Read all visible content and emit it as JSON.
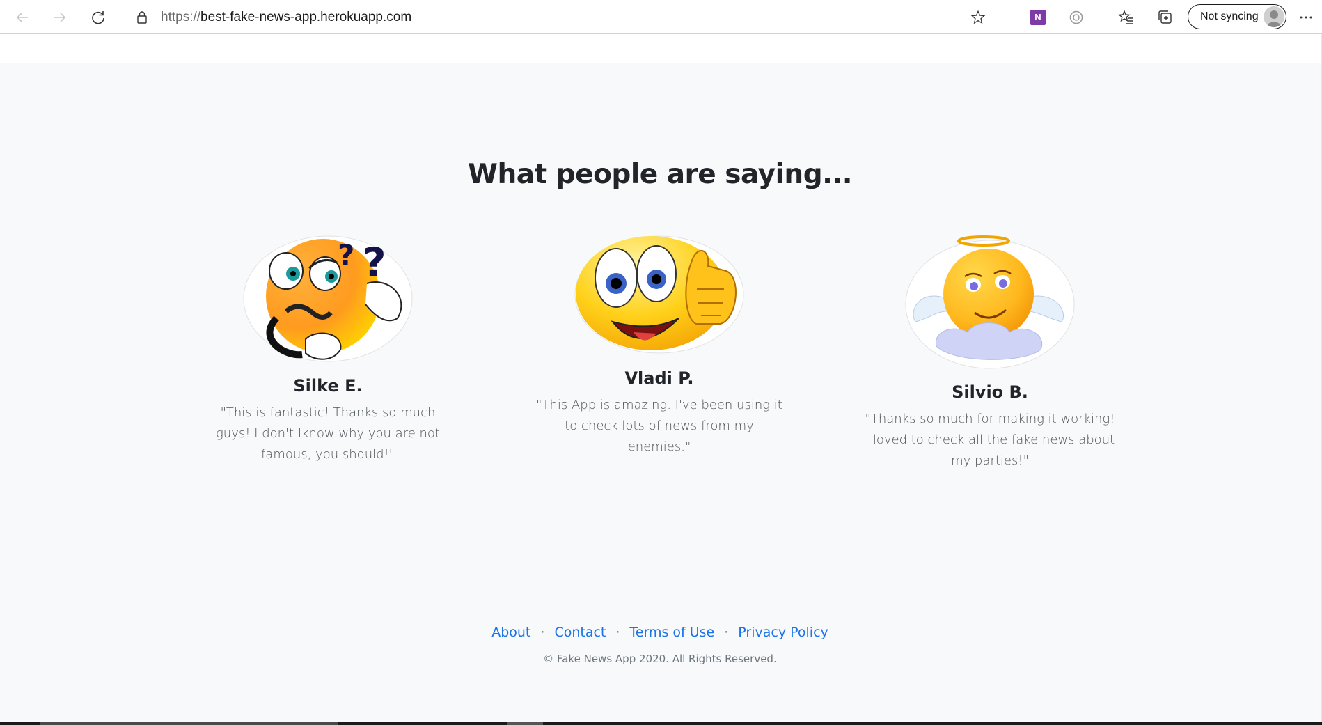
{
  "browser": {
    "url_scheme": "https://",
    "url_host": "best-fake-news-app.herokuapp.com",
    "sync_label": "Not syncing",
    "onenote_glyph": "N"
  },
  "page": {
    "heading": "What people are saying...",
    "testimonials": [
      {
        "name": "Silke E.",
        "quote": "\"This is fantastic! Thanks so much guys! I don't Iknow why you are not famous, you should!\"",
        "avatar_icon": "thinking-emoji"
      },
      {
        "name": "Vladi P.",
        "quote": "\"This App is amazing. I've been using it to check lots of news from my enemies.\"",
        "avatar_icon": "thumbs-up-emoji"
      },
      {
        "name": "Silvio B.",
        "quote": "\"Thanks so much for making it working! I loved to check all the fake news about my parties!\"",
        "avatar_icon": "angel-emoji"
      }
    ],
    "footer": {
      "links": [
        "About",
        "Contact",
        "Terms of Use",
        "Privacy Policy"
      ],
      "separator": "·",
      "copyright": "© Fake News App 2020. All Rights Reserved."
    }
  },
  "colors": {
    "page_bg": "#f8f9fa",
    "link": "#1a73e8",
    "heading": "#212529"
  }
}
